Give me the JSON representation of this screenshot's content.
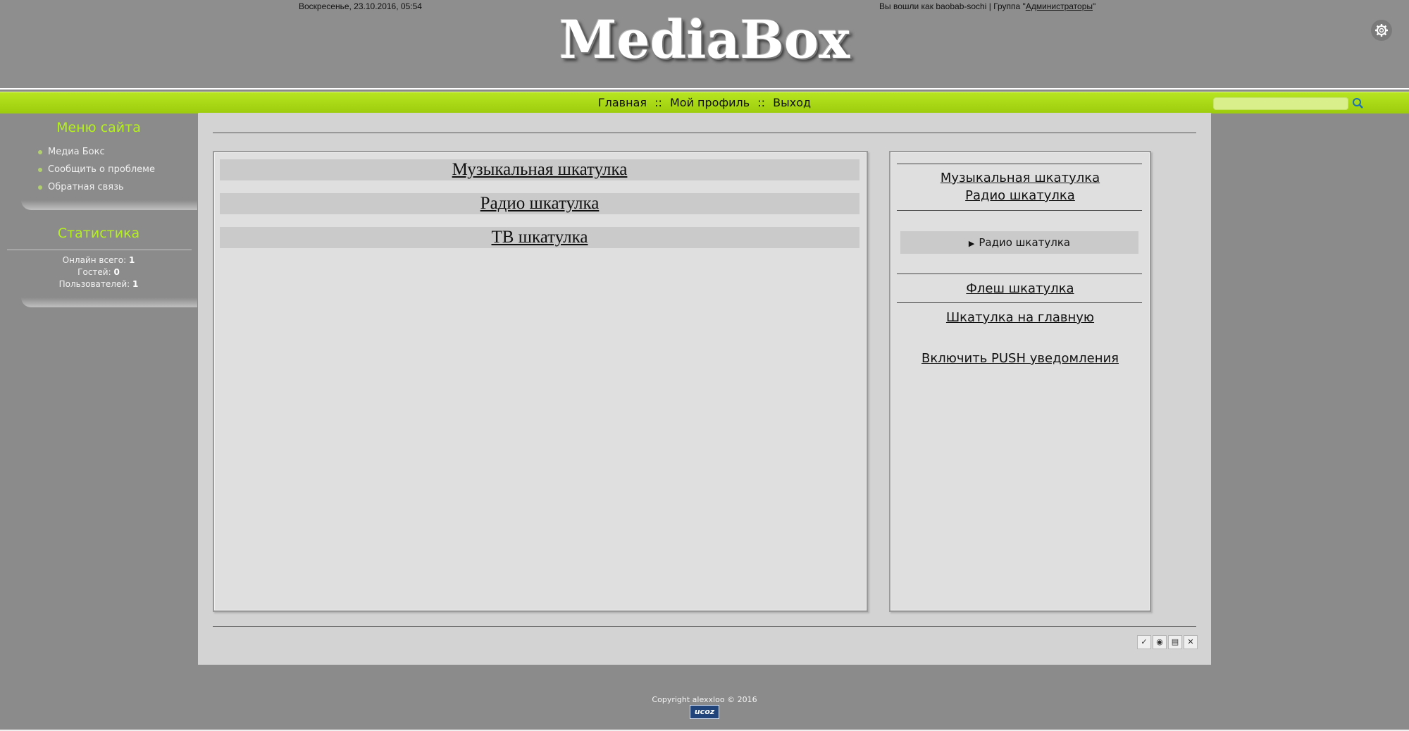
{
  "header": {
    "date": "Воскресенье, 23.10.2016, 05:54",
    "login_prefix": "Вы вошли как ",
    "username": "baobab-sochi",
    "group_prefix": " | Группа \"",
    "group_link": "Администраторы",
    "group_suffix": "\"",
    "logo": "MediaBox",
    "settings_icon": "gear-icon"
  },
  "nav": {
    "home": "Главная",
    "profile": "Мой профиль",
    "logout": "Выход",
    "separator": "::",
    "search_icon": "search-icon"
  },
  "sidebar": {
    "menu_title": "Меню сайта",
    "items": [
      {
        "label": "Медиа Бокс"
      },
      {
        "label": "Сообщить о проблеме"
      },
      {
        "label": "Обратная связь"
      }
    ],
    "stats_title": "Статистика",
    "stats": [
      {
        "label": "Онлайн всего: ",
        "value": "1"
      },
      {
        "label": "Гостей: ",
        "value": "0"
      },
      {
        "label": "Пользователей: ",
        "value": "1"
      }
    ]
  },
  "main": {
    "categories": [
      {
        "label": "Музыкальная шкатулка"
      },
      {
        "label": "Радио шкатулка"
      },
      {
        "label": "ТВ шкатулка"
      }
    ]
  },
  "right_panel": {
    "music": "Музыкальная шкатулка",
    "radio": "Радио шкатулка",
    "radio_expander": "Радио шкатулка",
    "flash": "Флеш шкатулка",
    "to_main": "Шкатулка на главную",
    "push": "Включить PUSH уведомления"
  },
  "tools": [
    "✓",
    "◉",
    "▤",
    "✕"
  ],
  "footer": {
    "copyright": "Copyright alexxloo © 2016",
    "ucoz": "ucoz"
  },
  "colors": {
    "accent_green": "#a8d914",
    "title_green": "#b5f21b",
    "background": "#8b8b8b",
    "content": "#d3d3d3"
  }
}
